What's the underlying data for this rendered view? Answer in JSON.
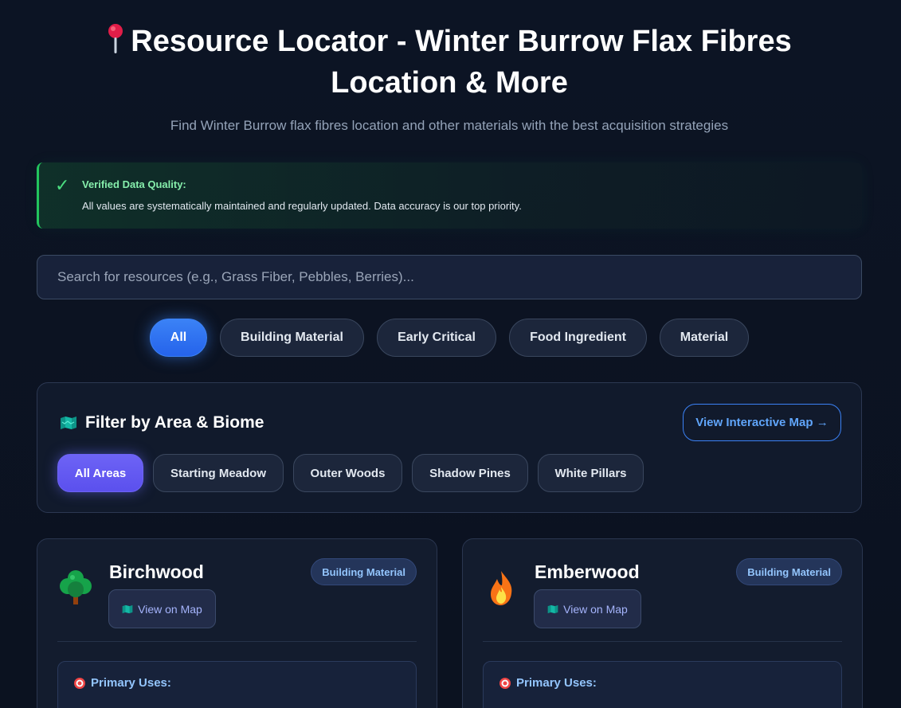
{
  "hero": {
    "title": "Resource Locator - Winter Burrow Flax Fibres Location & More",
    "subtitle": "Find Winter Burrow flax fibres location and other materials with the best acquisition strategies",
    "title_icon": "map-pin-icon"
  },
  "notice": {
    "icon": "check-icon",
    "title": "Verified Data Quality:",
    "body": "All values are systematically maintained and regularly updated. Data accuracy is our top priority.",
    "accent_color": "#22c55e"
  },
  "search": {
    "placeholder": "Search for resources (e.g., Grass Fiber, Pebbles, Berries)...",
    "value": ""
  },
  "categories": [
    {
      "label": "All",
      "active": true
    },
    {
      "label": "Building Material",
      "active": false
    },
    {
      "label": "Early Critical",
      "active": false
    },
    {
      "label": "Food Ingredient",
      "active": false
    },
    {
      "label": "Material",
      "active": false
    }
  ],
  "area_filter": {
    "icon": "map-icon",
    "title": "Filter by Area & Biome",
    "map_button": "View Interactive Map →",
    "areas": [
      {
        "label": "All Areas",
        "active": true
      },
      {
        "label": "Starting Meadow",
        "active": false
      },
      {
        "label": "Outer Woods",
        "active": false
      },
      {
        "label": "Shadow Pines",
        "active": false
      },
      {
        "label": "White Pillars",
        "active": false
      }
    ]
  },
  "resources": [
    {
      "name": "Birchwood",
      "icon": "tree-icon",
      "badge": "Building Material",
      "map_button": "View on Map",
      "uses_label": "Primary Uses:"
    },
    {
      "name": "Emberwood",
      "icon": "fire-icon",
      "badge": "Building Material",
      "map_button": "View on Map",
      "uses_label": "Primary Uses:"
    }
  ],
  "colors": {
    "background": "#0b1220",
    "primary_blue": "#3b82f6",
    "accent_purple": "#6366f1",
    "success_green": "#22c55e"
  }
}
